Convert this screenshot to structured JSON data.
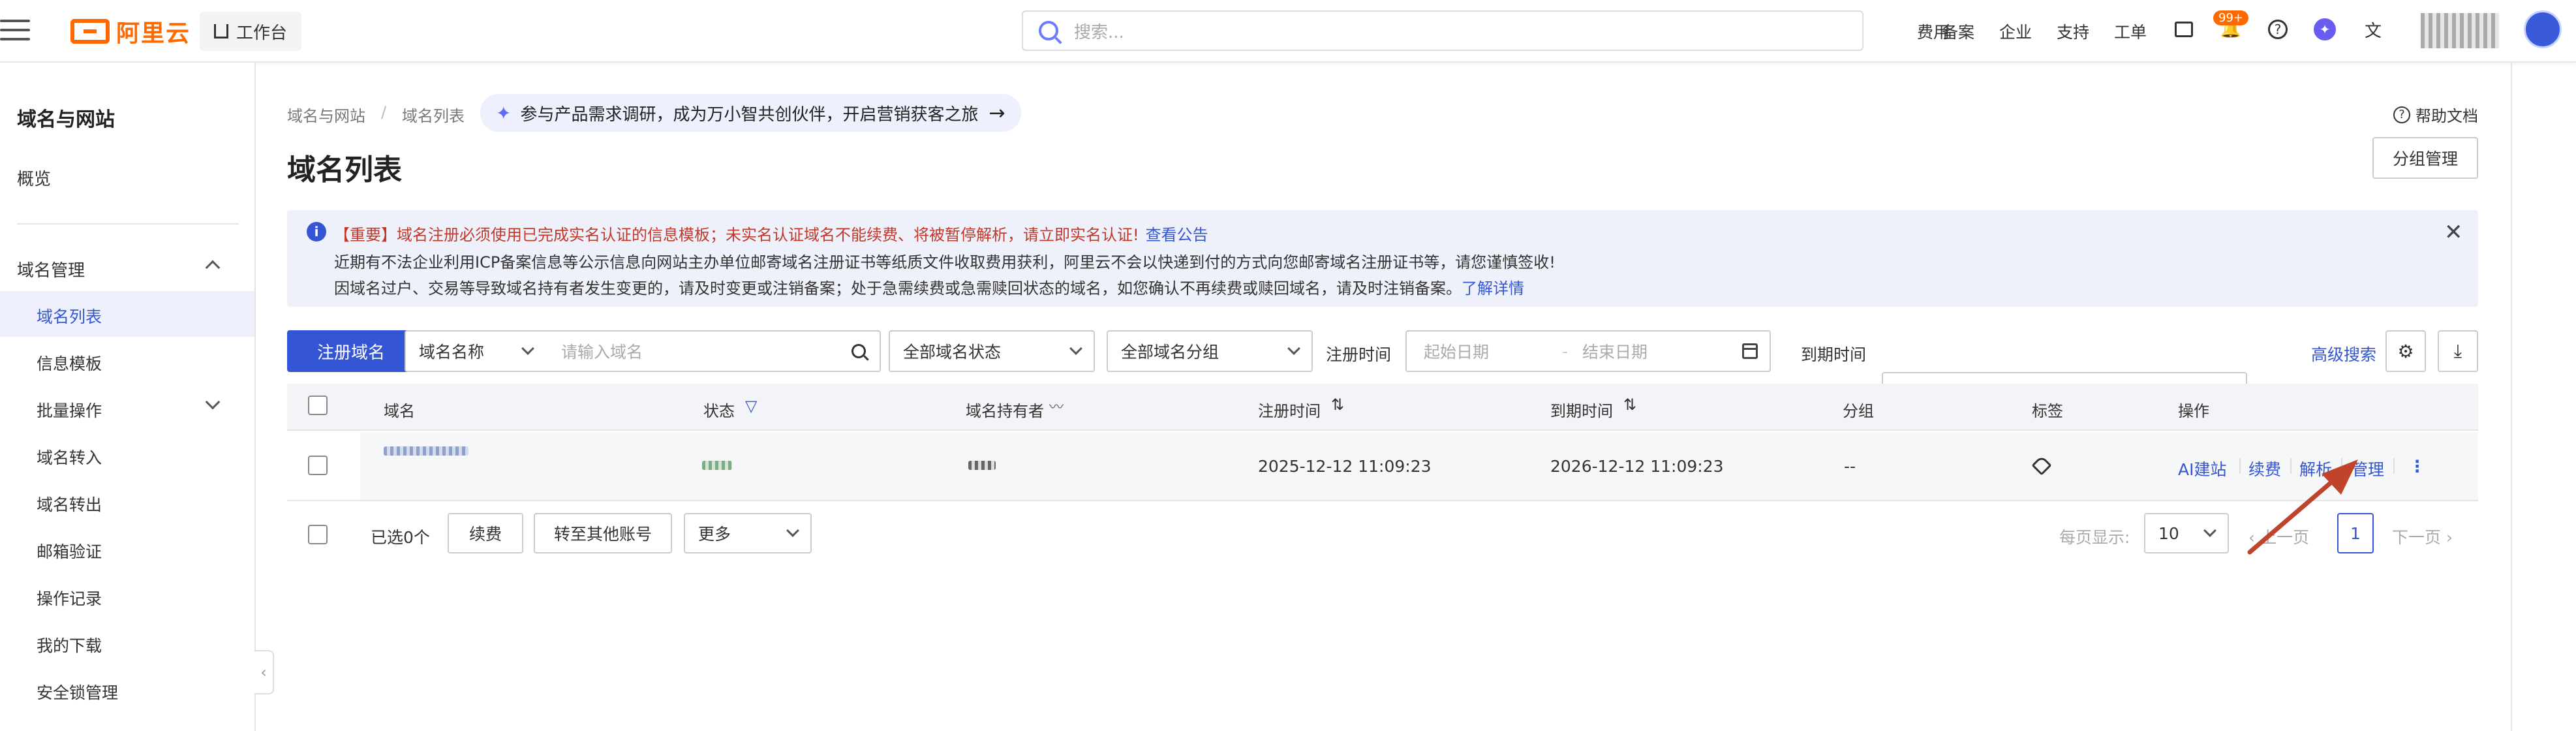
{
  "topbar": {
    "logo": "阿里云",
    "workbench": "工作台",
    "search_placeholder": "搜索...",
    "nav": [
      "费用",
      "备案",
      "企业",
      "支持",
      "工单"
    ],
    "badge": "99+"
  },
  "sidebar": {
    "title": "域名与网站",
    "overview": "概览",
    "group": "域名管理",
    "items": [
      "域名列表",
      "信息模板",
      "批量操作",
      "域名转入",
      "域名转出",
      "邮箱验证",
      "操作记录",
      "我的下载",
      "安全锁管理"
    ]
  },
  "breadcrumb": [
    "域名与网站",
    "/",
    "域名列表"
  ],
  "promo": "参与产品需求调研，成为万小智共创伙伴，开启营销获客之旅",
  "page_title": "域名列表",
  "help": "帮助文档",
  "group_manage": "分组管理",
  "notice": {
    "line1": "【重要】域名注册必须使用已完成实名认证的信息模板；未实名认证域名不能续费、将被暂停解析，请立即实名认证!",
    "line1_link": "查看公告",
    "line2": "近期有不法企业利用ICP备案信息等公示信息向网站主办单位邮寄域名注册证书等纸质文件收取费用获利，阿里云不会以快递到付的方式向您邮寄域名注册证书等，请您谨慎签收!",
    "line3": "因域名过户、交易等导致域名持有者发生变更的，请及时变更或注销备案；处于急需续费或急需赎回状态的域名，如您确认不再续费或赎回域名，请及时注销备案。",
    "line3_link": "了解详情"
  },
  "filters": {
    "register_btn": "注册域名",
    "field_select": "域名名称",
    "domain_placeholder": "请输入域名",
    "status_select": "全部域名状态",
    "group_select": "全部域名分组",
    "reg_time_label": "注册时间",
    "expire_time_label": "到期时间",
    "start_placeholder": "起始日期",
    "end_placeholder": "结束日期",
    "range_sep": "-",
    "advanced": "高级搜索"
  },
  "table": {
    "headers": [
      "域名",
      "状态",
      "域名持有者",
      "注册时间",
      "到期时间",
      "分组",
      "标签",
      "操作"
    ],
    "row": {
      "reg_time": "2025-12-12 11:09:23",
      "expire_time": "2026-12-12 11:09:23",
      "group": "--",
      "actions": [
        "AI建站",
        "续费",
        "解析",
        "管理"
      ]
    }
  },
  "footer": {
    "selected": "已选0个",
    "renew": "续费",
    "transfer": "转至其他账号",
    "more": "更多",
    "per_page_label": "每页显示:",
    "per_page": "10",
    "prev": "上一页",
    "page": "1",
    "next": "下一页"
  },
  "colors": {
    "brand": "#ff6a00",
    "primary": "#3456d4",
    "warning_text": "#c0392b",
    "annotation_arrow": "#c0442a"
  }
}
